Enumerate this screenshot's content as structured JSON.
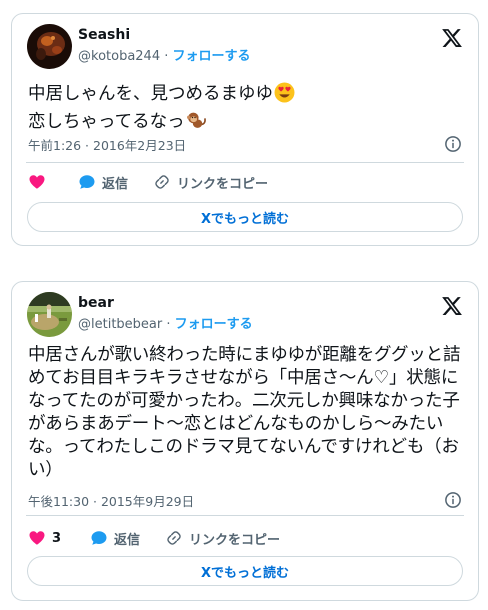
{
  "tweets": [
    {
      "user_name": "Seashi",
      "handle": "@kotoba244",
      "separator": "·",
      "follow_label": "フォローする",
      "text_line1": "中居しゃんを、見つめるまゆゆ",
      "text_line2": "恋しちゃってるなっ",
      "timestamp": "午前1:26 · 2016年2月23日",
      "like_count": "",
      "reply_label": "返信",
      "copy_link_label": "リンクをコピー",
      "more_label": "Xでもっと読む",
      "icons": [
        "heart-eyes-emoji",
        "monkey-emoji"
      ]
    },
    {
      "user_name": "bear",
      "handle": "@letitbebear",
      "separator": "·",
      "follow_label": "フォローする",
      "text": "中居さんが歌い終わった時にまゆゆが距離をググッと詰めてお目目キラキラさせながら「中居さ〜ん♡」状態になってたのが可愛かったわ。二次元しか興味なかった子があらまあデート〜恋とはどんなものかしら〜みたいな。ってわたしこのドラマ見てないんですけれども（おい）",
      "timestamp": "午後11:30 · 2015年9月29日",
      "like_count": "3",
      "reply_label": "返信",
      "copy_link_label": "リンクをコピー",
      "more_label": "Xでもっと読む"
    }
  ],
  "colors": {
    "like": "#f91880",
    "reply": "#1d9bf0",
    "follow": "#1d9bf0",
    "more_link": "#006fd6",
    "muted": "#536471",
    "border": "#cfd9de"
  }
}
